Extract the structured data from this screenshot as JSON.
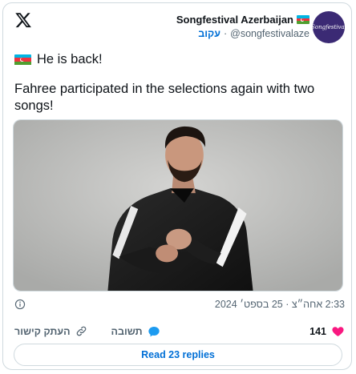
{
  "author": {
    "name": "Songfestival Azerbaijan",
    "handle": "@songfestivalaze",
    "follow_label": "עקוב",
    "avatar_text": "Songfestival"
  },
  "tweet": {
    "line1": "He is back!",
    "line2": "Fahree participated in the selections again with two songs!"
  },
  "meta": {
    "timestamp": "2:33 אחה״צ · 25 בספט׳ 2024"
  },
  "actions": {
    "like_count": "141",
    "reply_label": "תשובה",
    "copy_link_label": "העתק קישור"
  },
  "read_replies_label": "Read 23 replies",
  "colors": {
    "link_blue": "#006fd6",
    "like_pink": "#f91880",
    "reply_blue": "#1d9bf0",
    "border": "#cfd9de"
  },
  "icons": [
    "x-logo-icon",
    "azerbaijan-flag-icon",
    "info-icon",
    "heart-icon",
    "reply-bubble-icon",
    "link-icon"
  ]
}
